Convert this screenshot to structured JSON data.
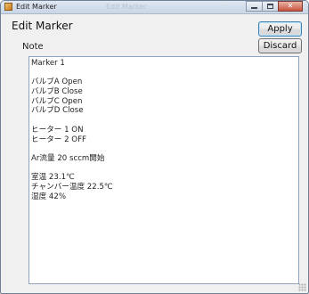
{
  "window": {
    "title": "Edit Marker",
    "background_title": "Edit Marker"
  },
  "header": {
    "heading": "Edit Marker",
    "note_label": "Note"
  },
  "buttons": {
    "apply": "Apply",
    "discard": "Discard"
  },
  "note": {
    "lines": [
      "Marker 1",
      "",
      "バルブA Open",
      "バルブB Close",
      "バルブC Open",
      "バルブD Close",
      "",
      "ヒーター 1 ON",
      "ヒーター 2 OFF",
      "",
      "Ar流量 20 sccm開始",
      "",
      "室温 23.1℃",
      "チャンバー温度 22.5℃",
      "湿度 42%"
    ]
  },
  "colors": {
    "window_bg": "#f0f0f0",
    "apply_border": "#3c7fb1",
    "note_border": "#8fa3bf"
  }
}
